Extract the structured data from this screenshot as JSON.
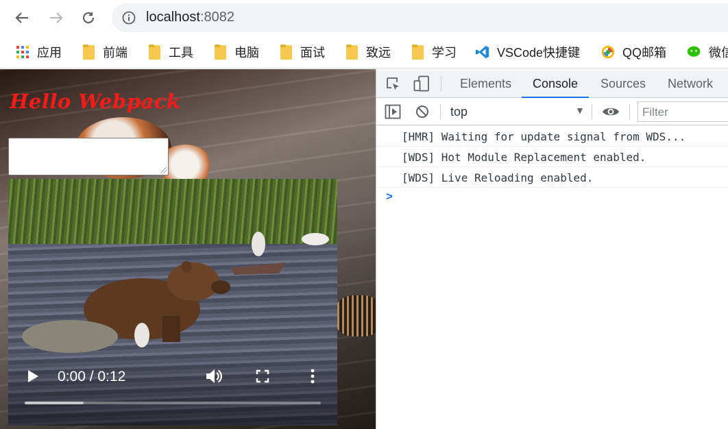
{
  "browser": {
    "url_host": "localhost",
    "url_port": ":8082",
    "bookmarks": [
      {
        "label": "应用",
        "icon": "apps-grid-icon"
      },
      {
        "label": "前端",
        "icon": "folder-icon"
      },
      {
        "label": "工具",
        "icon": "folder-icon"
      },
      {
        "label": "电脑",
        "icon": "folder-icon"
      },
      {
        "label": "面试",
        "icon": "folder-icon"
      },
      {
        "label": "致远",
        "icon": "folder-icon"
      },
      {
        "label": "学习",
        "icon": "folder-icon"
      },
      {
        "label": "VSCode快捷键",
        "icon": "vscode-icon"
      },
      {
        "label": "QQ邮箱",
        "icon": "qq-mail-icon"
      },
      {
        "label": "微信",
        "icon": "wechat-icon"
      }
    ]
  },
  "page": {
    "heading": "Hello Webpack",
    "textarea_value": "",
    "video": {
      "time": "0:00 / 0:12",
      "buffered_fraction": 0.2
    }
  },
  "devtools": {
    "tabs": [
      "Elements",
      "Console",
      "Sources",
      "Network"
    ],
    "active_tab": "Console",
    "context": "top",
    "filter_placeholder": "Filter",
    "logs": [
      "[HMR] Waiting for update signal from WDS...",
      "[WDS] Hot Module Replacement enabled.",
      "[WDS] Live Reloading enabled."
    ],
    "prompt": ">"
  },
  "colors": {
    "heading": "#ff1a1a",
    "accent": "#1a73e8"
  }
}
